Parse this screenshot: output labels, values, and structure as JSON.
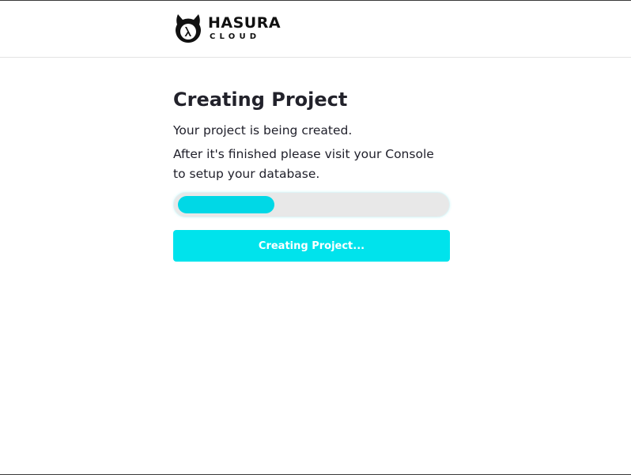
{
  "header": {
    "logo": {
      "brand": "HASURA",
      "sub": "CLOUD",
      "icon": "hasura-lambda-icon"
    }
  },
  "main": {
    "title": "Creating Project",
    "status_line": "Your project is being created.",
    "info_line": "After it's finished please visit your Console to setup your database.",
    "progress": {
      "fraction": 0.36,
      "fill_color": "#00d8e6",
      "track_color": "#e8e8e8"
    },
    "button": {
      "label": "Creating Project...",
      "color": "#00e3ec"
    }
  }
}
